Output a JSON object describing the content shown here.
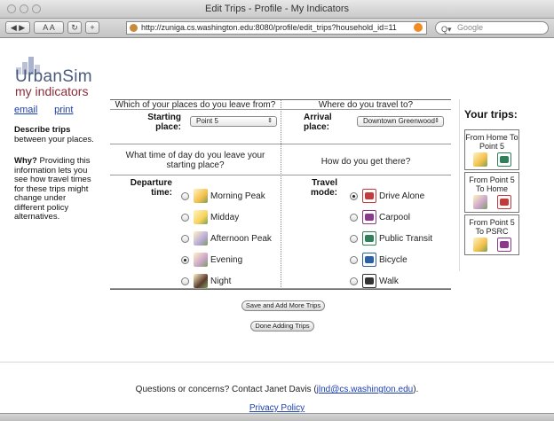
{
  "window": {
    "title": "Edit Trips - Profile - My Indicators",
    "url": "http://zuniga.cs.washington.edu:8080/profile/edit_trips?household_id=11",
    "search_placeholder": "Google",
    "toolbar": {
      "text_size_label": "A A"
    }
  },
  "logo": {
    "name": "UrbanSim",
    "tagline": "my indicators"
  },
  "sidebar": {
    "links": [
      "email",
      "print"
    ],
    "describe_title": "Describe trips",
    "describe_text": "between your places.",
    "why_title": "Why?",
    "why_text": "Providing this information lets you see how travel times for these trips might change under different policy alternatives."
  },
  "form": {
    "q_leave_from": "Which of your places do you leave from?",
    "q_travel_to": "Where do you travel to?",
    "starting_place_label": "Starting place:",
    "starting_place_value": "Point 5",
    "arrival_place_label": "Arrival place:",
    "arrival_place_value": "Downtown Greenwood",
    "q_time_of_day": "What time of day do you leave your starting place?",
    "q_how": "How do you get there?",
    "departure_label": "Departure time:",
    "travel_mode_label": "Travel mode:",
    "departure_options": [
      {
        "label": "Morning Peak",
        "selected": false,
        "icon": "morning-peak-icon",
        "color": "#f2c04a"
      },
      {
        "label": "Midday",
        "selected": false,
        "icon": "midday-sun-icon",
        "color": "#f7d35a"
      },
      {
        "label": "Afternoon Peak",
        "selected": false,
        "icon": "afternoon-peak-icon",
        "color": "#b8a9d8"
      },
      {
        "label": "Evening",
        "selected": true,
        "icon": "evening-icon",
        "color": "#c9a3c9"
      },
      {
        "label": "Night",
        "selected": false,
        "icon": "night-icon",
        "color": "#5b3b2e"
      }
    ],
    "mode_options": [
      {
        "label": "Drive Alone",
        "selected": true,
        "icon": "car-icon",
        "color": "#c23a3a"
      },
      {
        "label": "Carpool",
        "selected": false,
        "icon": "carpool-icon",
        "color": "#8b3a8b"
      },
      {
        "label": "Public Transit",
        "selected": false,
        "icon": "bus-icon",
        "color": "#2f7f5a"
      },
      {
        "label": "Bicycle",
        "selected": false,
        "icon": "bicycle-icon",
        "color": "#2b5fa8"
      },
      {
        "label": "Walk",
        "selected": false,
        "icon": "walk-icon",
        "color": "#333333"
      }
    ],
    "save_add_label": "Save and Add More Trips",
    "done_label": "Done Adding Trips"
  },
  "trips": {
    "title": "Your trips:",
    "items": [
      {
        "label": "From Home To Point 5",
        "time_icon": "morning-peak-icon",
        "mode_icon": "bus-icon"
      },
      {
        "label": "From Point 5 To Home",
        "time_icon": "evening-icon",
        "mode_icon": "car-icon"
      },
      {
        "label": "From Point 5 To PSRC",
        "time_icon": "morning-peak-icon",
        "mode_icon": "carpool-icon"
      }
    ]
  },
  "footer": {
    "contact_prefix": "Questions or concerns? Contact Janet Davis (",
    "contact_email": "jlnd@cs.washington.edu",
    "contact_suffix": ").",
    "privacy": "Privacy Policy"
  }
}
